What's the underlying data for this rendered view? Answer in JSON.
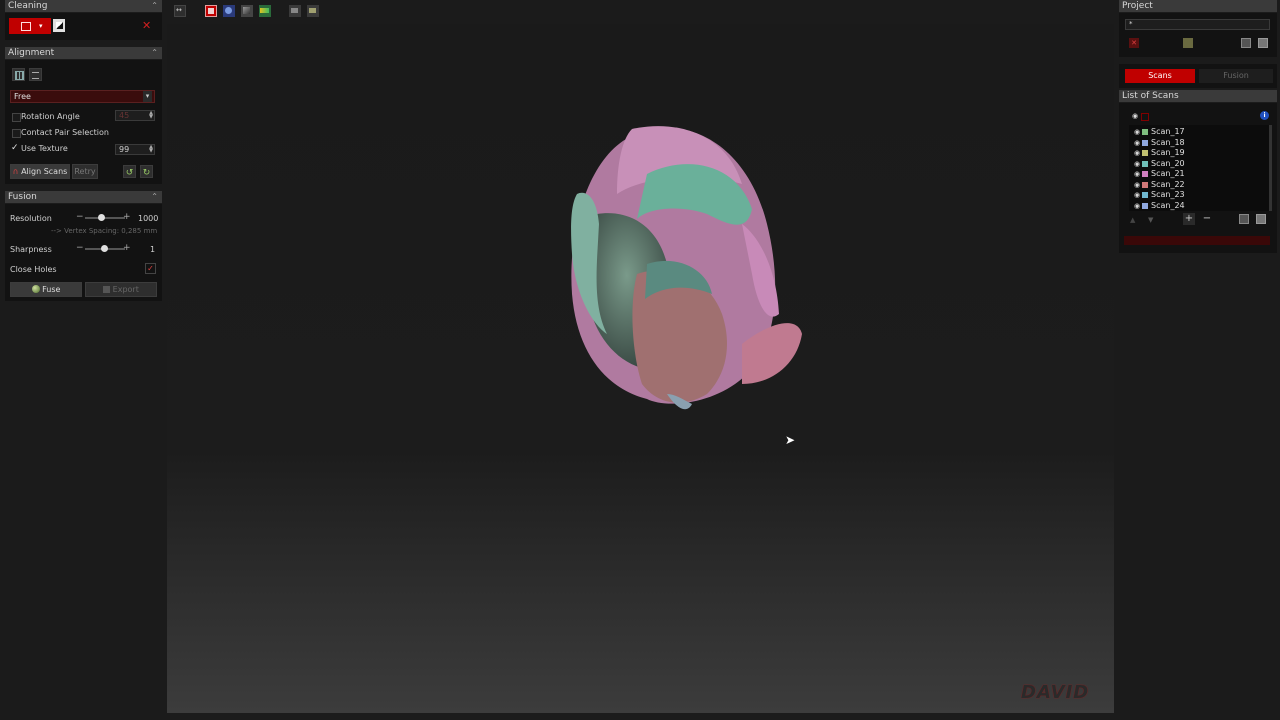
{
  "left_panel": {
    "cleaning": {
      "title": "Cleaning"
    },
    "alignment": {
      "title": "Alignment",
      "mode": "Free",
      "rotation_angle_label": "Rotation Angle",
      "rotation_angle_value": "45",
      "contact_pair_label": "Contact Pair Selection",
      "use_texture_label": "Use Texture",
      "use_texture_value": "99",
      "align_scans_label": "Align Scans",
      "retry_label": "Retry"
    },
    "fusion": {
      "title": "Fusion",
      "resolution_label": "Resolution",
      "resolution_value": "1000",
      "vertex_spacing": "--> Vertex Spacing: 0,285 mm",
      "sharpness_label": "Sharpness",
      "sharpness_value": "1",
      "close_holes_label": "Close Holes",
      "fuse_label": "Fuse",
      "export_label": "Export"
    }
  },
  "right_panel": {
    "project_title": "Project",
    "project_name": "*",
    "tabs": {
      "scans": "Scans",
      "fusion": "Fusion"
    },
    "list_title": "List of Scans",
    "scans": [
      {
        "name": "Scan_17",
        "color": "#7fbf7f"
      },
      {
        "name": "Scan_18",
        "color": "#8fa8e0"
      },
      {
        "name": "Scan_19",
        "color": "#c0c070"
      },
      {
        "name": "Scan_20",
        "color": "#6fc0b8"
      },
      {
        "name": "Scan_21",
        "color": "#d080c0"
      },
      {
        "name": "Scan_22",
        "color": "#d07878"
      },
      {
        "name": "Scan_23",
        "color": "#70b8d0"
      },
      {
        "name": "Scan_24",
        "color": "#8fa8e0"
      }
    ]
  },
  "viewport": {
    "watermark": "DAVID"
  },
  "colors": {
    "accent": "#c00000",
    "panel_bg": "#1b1b1b"
  }
}
